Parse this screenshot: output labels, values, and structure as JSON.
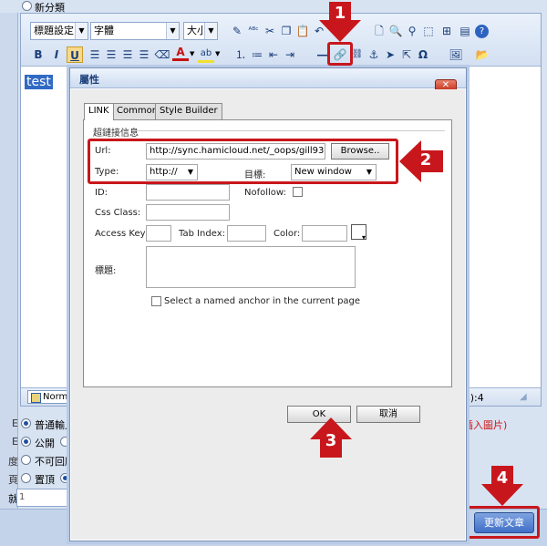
{
  "top": {
    "new_category_label": "新分類"
  },
  "toolbar": {
    "format_select": "標題設定",
    "font_select": "字體",
    "size_select": "大小",
    "bold": "B",
    "italic": "I",
    "underline": "U",
    "font_color": "A",
    "special_char": "Ω"
  },
  "editor": {
    "selected_text": "test",
    "style_tag": "Normal",
    "word_count": "s):4"
  },
  "options": {
    "row1_side": "E",
    "row1_label": "普通輸入",
    "row2_side": "E",
    "row2_label": "公開",
    "row3_side": "度",
    "row3_label": "不可回應",
    "row4_side": "頁",
    "row4_label": "置頂",
    "row5_side": "就",
    "bottom_input_value": "1",
    "insert_image_label": "插入圖片)"
  },
  "dialog": {
    "title": "屬性",
    "close_label": "✕",
    "tabs": [
      "LINK",
      "Common",
      "Style Builder"
    ],
    "section_title": "超鏈接信息",
    "url_label": "Url:",
    "url_value": "http://sync.hamicloud.net/_oops/gill9311/q2",
    "browse_label": "Browse..",
    "type_label": "Type:",
    "type_value": "http://",
    "target_label": "目標:",
    "target_value": "New window",
    "id_label": "ID:",
    "nofollow_label": "Nofollow:",
    "css_label": "Css Class:",
    "access_key_label": "Access Key:",
    "tab_index_label": "Tab Index:",
    "color_label": "Color:",
    "title_label": "標題:",
    "anchor_label": "Select a named anchor in the current page",
    "ok_label": "OK",
    "cancel_label": "取消"
  },
  "footer": {
    "update_label": "更新文章"
  },
  "annotations": {
    "step1": "1",
    "step2": "2",
    "step3": "3",
    "step4": "4",
    "color": "#c8171c"
  }
}
